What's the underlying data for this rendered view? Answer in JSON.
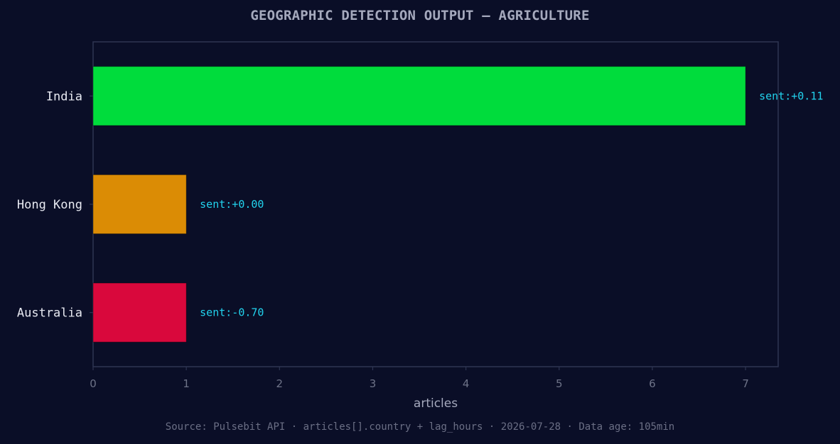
{
  "chart_data": {
    "type": "bar",
    "orientation": "horizontal",
    "title": "GEOGRAPHIC DETECTION OUTPUT — AGRICULTURE",
    "xlabel": "articles",
    "ylabel": "",
    "xlim": [
      0,
      7.35
    ],
    "xticks": [
      0,
      1,
      2,
      3,
      4,
      5,
      6,
      7
    ],
    "grid": false,
    "categories": [
      "India",
      "Hong Kong",
      "Australia"
    ],
    "values": [
      7,
      1,
      1
    ],
    "colors": [
      "#00dc3c",
      "#db8c05",
      "#d9083c"
    ],
    "annotations": [
      "sent:+0.11",
      "sent:+0.00",
      "sent:-0.70"
    ]
  },
  "colors": {
    "background": "#0a0e27",
    "axis": "#2e3552",
    "tick_text": "#6e7388",
    "category_text": "#e8eaf2",
    "annotation": "#22d3ee",
    "xlabel_text": "#a5a9bd"
  },
  "footer": "Source: Pulsebit API · articles[].country + lag_hours · 2026-07-28 · Data age: 105min"
}
